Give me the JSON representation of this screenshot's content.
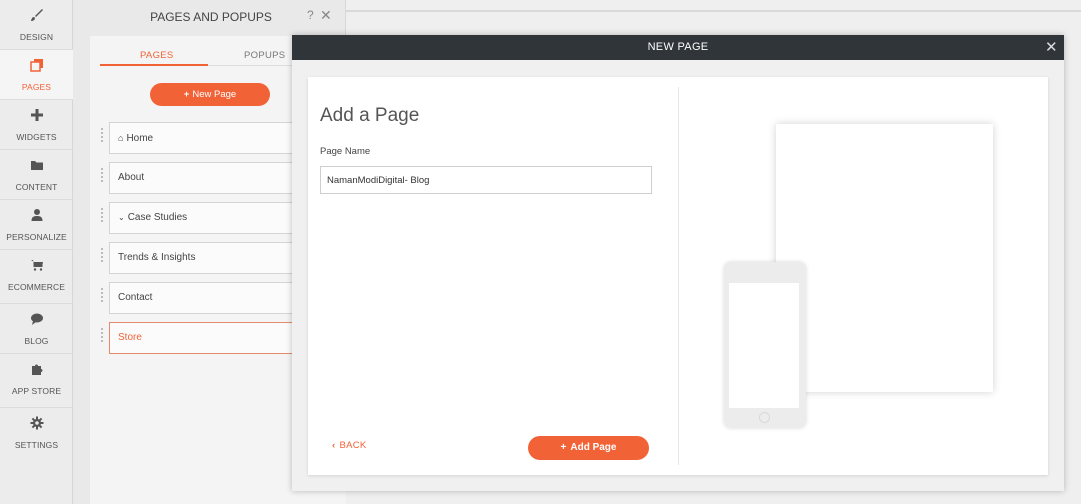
{
  "leftnav": {
    "items": [
      {
        "label": "DESIGN",
        "icon": "brush-icon"
      },
      {
        "label": "PAGES",
        "icon": "pages-icon"
      },
      {
        "label": "WIDGETS",
        "icon": "plus-icon"
      },
      {
        "label": "CONTENT",
        "icon": "folder-icon"
      },
      {
        "label": "PERSONALIZE",
        "icon": "person-icon"
      },
      {
        "label": "ECOMMERCE",
        "icon": "cart-icon"
      },
      {
        "label": "BLOG",
        "icon": "speech-bubble-icon"
      },
      {
        "label": "APP STORE",
        "icon": "puzzle-icon"
      },
      {
        "label": "SETTINGS",
        "icon": "gear-icon"
      }
    ],
    "active": "PAGES"
  },
  "pages_panel": {
    "title": "PAGES AND POPUPS",
    "help": "?",
    "close": "✕",
    "tabs": [
      "PAGES",
      "POPUPS"
    ],
    "new_page_label": "New Page",
    "pages": [
      {
        "label": "Home"
      },
      {
        "label": "About"
      },
      {
        "label": "Case Studies"
      },
      {
        "label": "Trends & Insights"
      },
      {
        "label": "Contact"
      },
      {
        "label": "Store"
      }
    ]
  },
  "modal": {
    "title": "NEW PAGE",
    "close": "✕",
    "heading": "Add a Page",
    "name_label": "Page Name",
    "name_value": "NamanModiDigital- Blog",
    "back_label": "BACK",
    "add_label": "Add Page"
  },
  "colors": {
    "accent": "#f26237",
    "header": "#2f3539"
  }
}
